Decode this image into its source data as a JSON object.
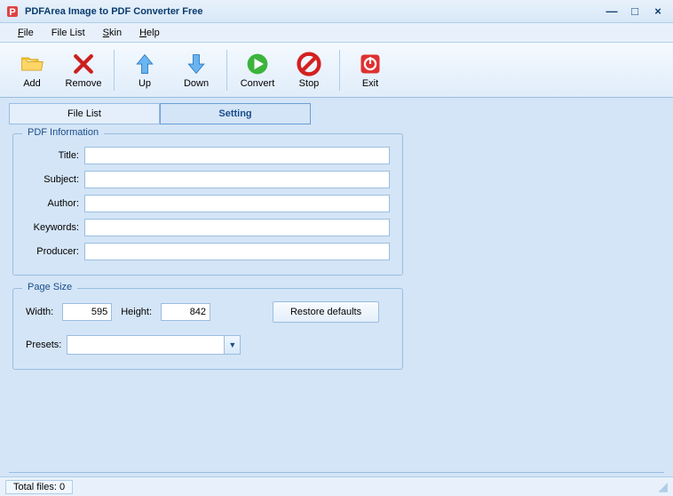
{
  "window": {
    "title": "PDFArea Image to PDF Converter Free"
  },
  "menu": {
    "file": "File",
    "filelist": "File List",
    "skin": "Skin",
    "help": "Help"
  },
  "toolbar": {
    "add": "Add",
    "remove": "Remove",
    "up": "Up",
    "down": "Down",
    "convert": "Convert",
    "stop": "Stop",
    "exit": "Exit"
  },
  "tabs": {
    "filelist": "File List",
    "setting": "Setting"
  },
  "pdfinfo": {
    "legend": "PDF Information",
    "title_label": "Title:",
    "subject_label": "Subject:",
    "author_label": "Author:",
    "keywords_label": "Keywords:",
    "producer_label": "Producer:",
    "title": "",
    "subject": "",
    "author": "",
    "keywords": "",
    "producer": ""
  },
  "pagesize": {
    "legend": "Page Size",
    "width_label": "Width:",
    "height_label": "Height:",
    "width": "595",
    "height": "842",
    "restore": "Restore defaults",
    "presets_label": "Presets:",
    "presets_value": ""
  },
  "status": {
    "total_files": "Total files: 0"
  }
}
